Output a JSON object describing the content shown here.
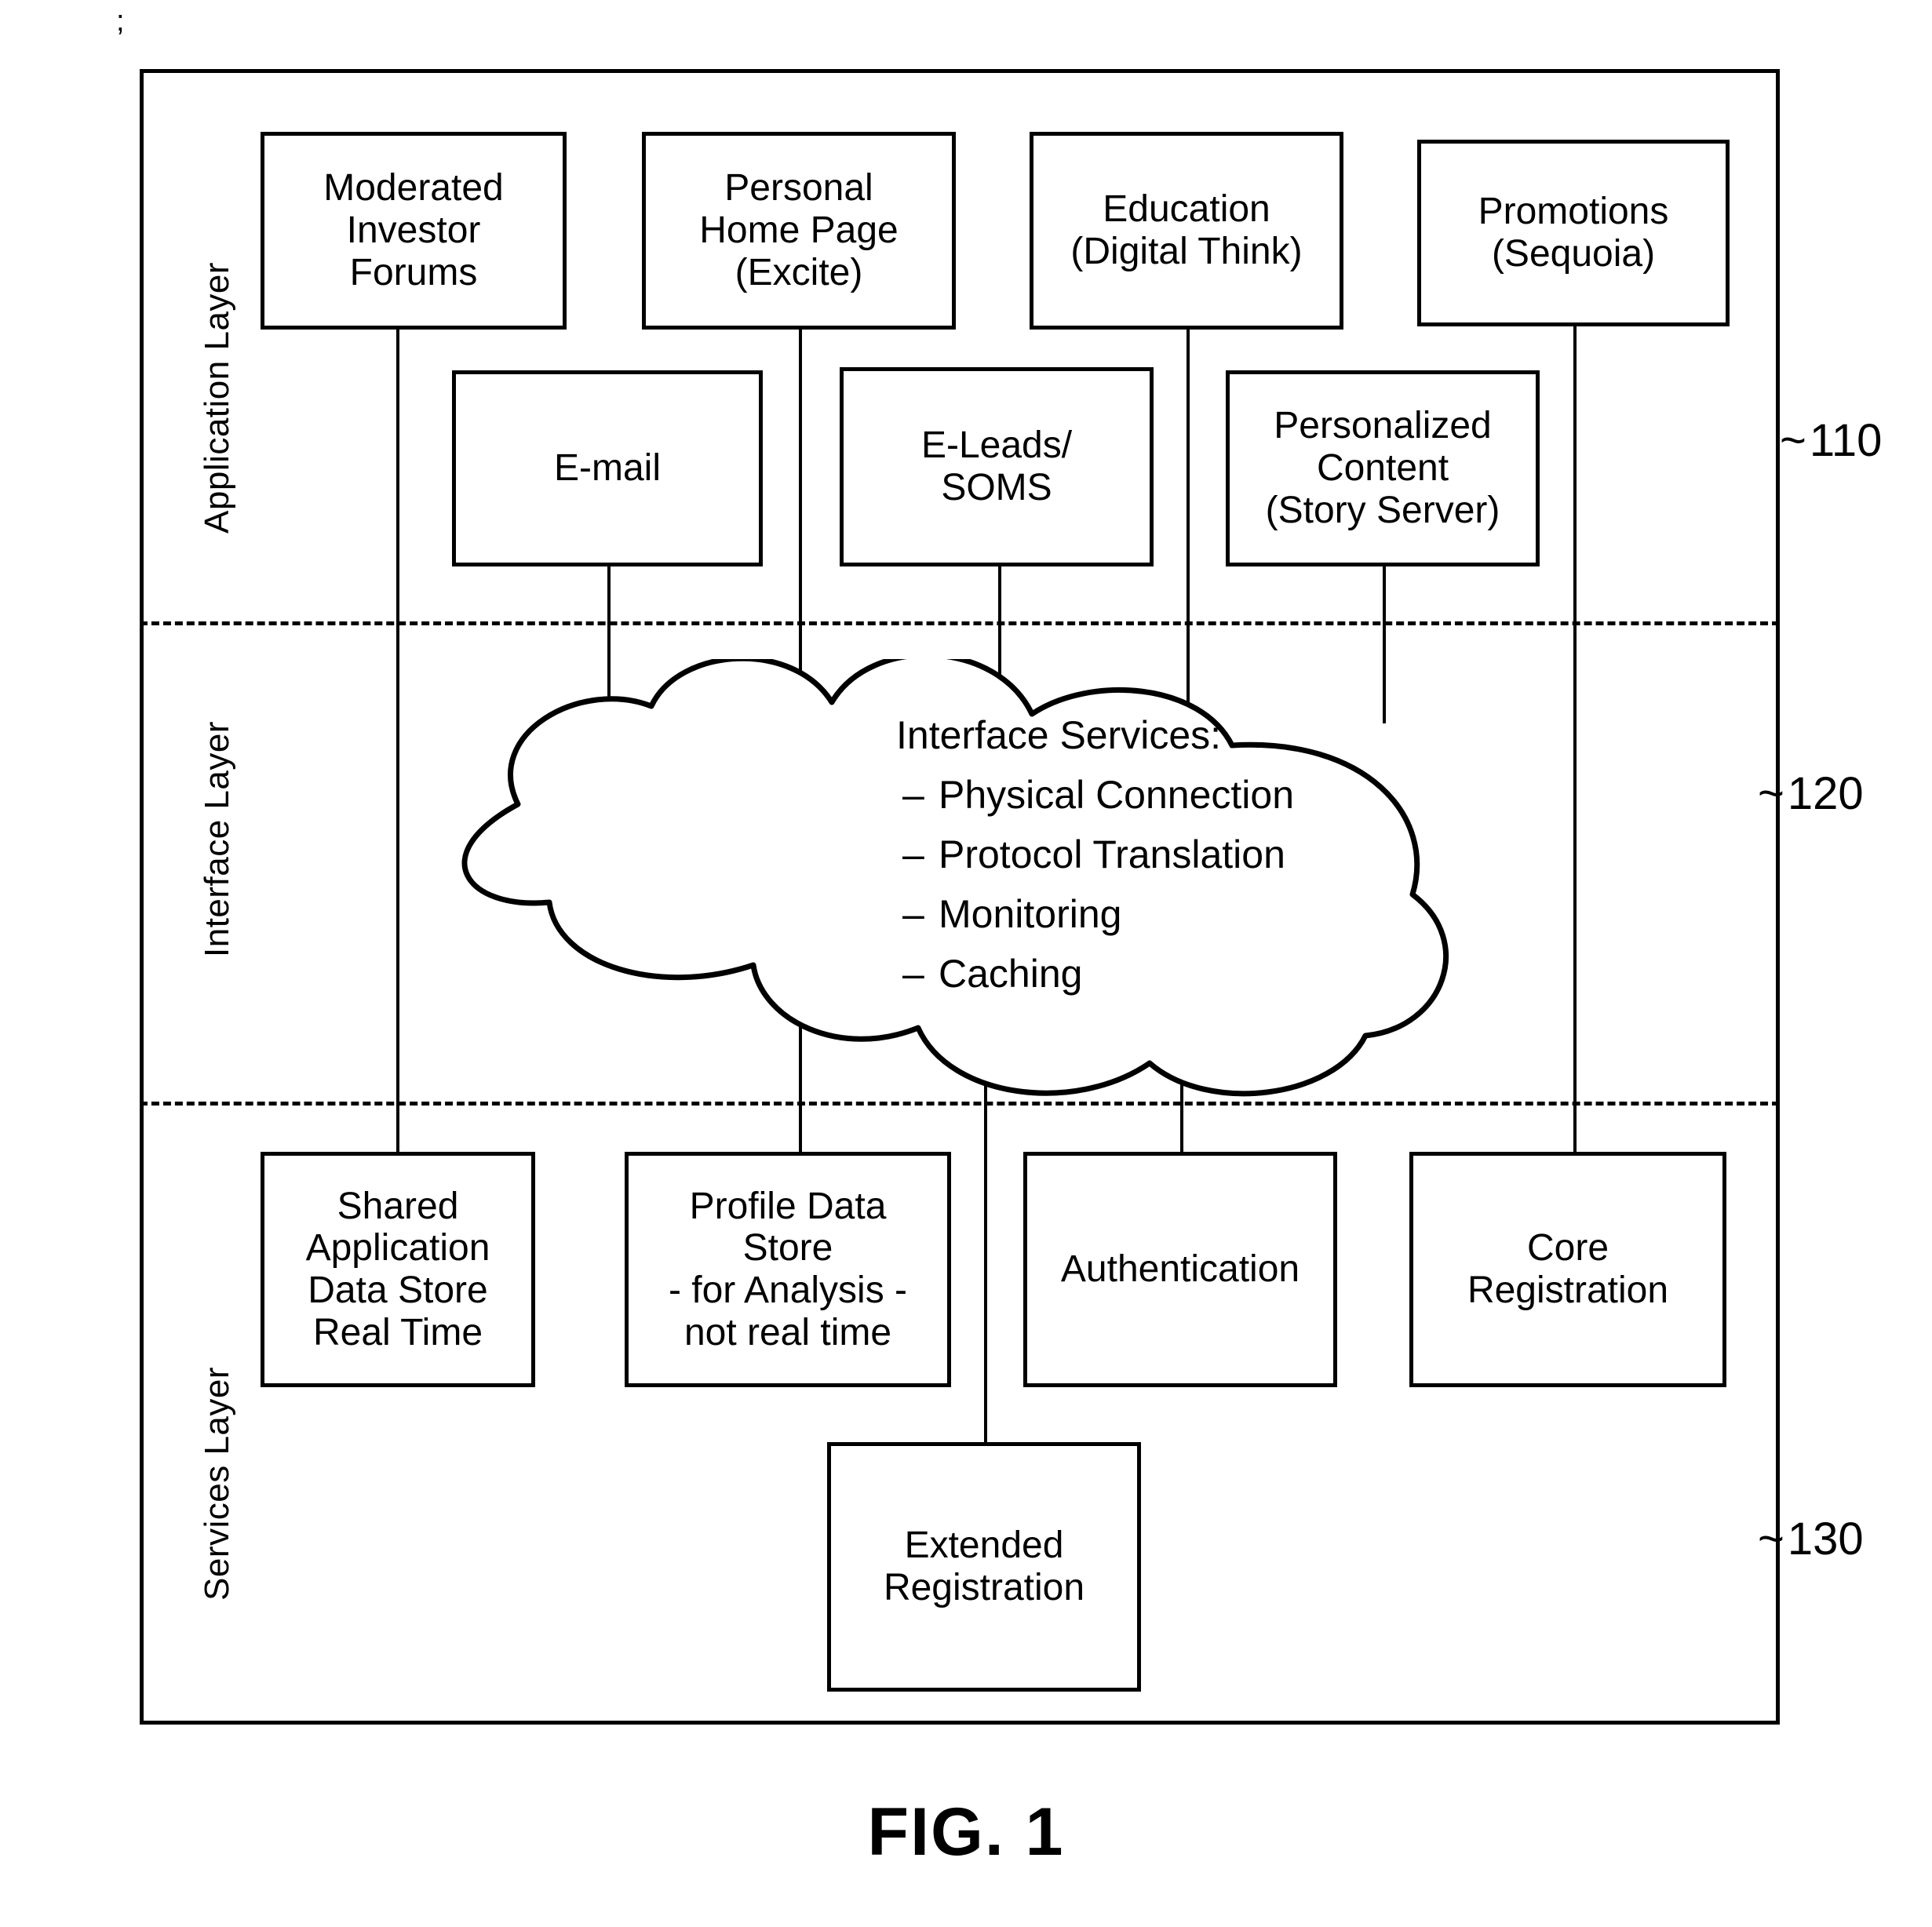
{
  "figure": {
    "caption": "FIG. 1",
    "stray_mark": ";"
  },
  "layers": [
    {
      "id": "application",
      "label": "Application Layer",
      "ref": "110",
      "ref_prefix": "~"
    },
    {
      "id": "interface",
      "label": "Interface Layer",
      "ref": "120",
      "ref_prefix": "~"
    },
    {
      "id": "services",
      "label": "Services Layer",
      "ref": "130",
      "ref_prefix": "~"
    }
  ],
  "application_layer": {
    "row1": [
      {
        "id": "moderated-investor-forums",
        "label": "Moderated\nInvestor\nForums"
      },
      {
        "id": "personal-home-page",
        "label": "Personal\nHome Page\n(Excite)"
      },
      {
        "id": "education",
        "label": "Education\n(Digital Think)"
      },
      {
        "id": "promotions",
        "label": "Promotions\n(Sequoia)"
      }
    ],
    "row2": [
      {
        "id": "email",
        "label": "E-mail"
      },
      {
        "id": "e-leads-soms",
        "label": "E-Leads/\nSOMS"
      },
      {
        "id": "personalized-content",
        "label": "Personalized\nContent\n(Story Server)"
      }
    ]
  },
  "interface_layer": {
    "cloud": {
      "title": "Interface Services:",
      "items": [
        "Physical Connection",
        "Protocol Translation",
        "Monitoring",
        "Caching"
      ]
    }
  },
  "services_layer": {
    "row1": [
      {
        "id": "shared-app-data-store",
        "label": "Shared\nApplication\nData Store\nReal Time"
      },
      {
        "id": "profile-data-store",
        "label": "Profile Data\nStore\n- for Analysis -\nnot real time"
      },
      {
        "id": "authentication",
        "label": "Authentication"
      },
      {
        "id": "core-registration",
        "label": "Core\nRegistration"
      }
    ],
    "row2": [
      {
        "id": "extended-registration",
        "label": "Extended\nRegistration"
      }
    ]
  },
  "colors": {
    "ink": "#000000",
    "paper": "#ffffff"
  }
}
